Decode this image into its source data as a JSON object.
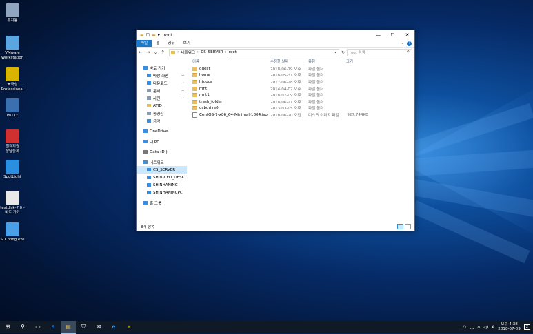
{
  "desktop": {
    "icons": [
      {
        "label": "휴지통",
        "icon": "recycle-bin-icon",
        "color": "#8fa5c0"
      },
      {
        "label": "VMware\nWorkstation",
        "icon": "vmware-icon",
        "color": "#5aa6e0"
      },
      {
        "label": "북극성\nProfessional",
        "icon": "compass-icon",
        "color": "#d8b400"
      },
      {
        "label": "PuTTY",
        "icon": "putty-icon",
        "color": "#3a6fb0"
      },
      {
        "label": "원격지원\n상담등록",
        "icon": "remote-support-icon",
        "color": "#d03030"
      },
      {
        "label": "SpotLight",
        "icon": "spotlight-icon",
        "color": "#2a8fe0"
      },
      {
        "label": "testdisk-7.0 -\n바로 가기",
        "icon": "document-icon",
        "color": "#e8e8e8"
      },
      {
        "label": "SLConfig.exe",
        "icon": "config-icon",
        "color": "#4aa0e8"
      }
    ]
  },
  "window": {
    "title": "root",
    "quick_access": [
      "▬",
      "☐",
      "▾"
    ],
    "controls": {
      "minimize": "—",
      "maximize": "☐",
      "close": "✕"
    },
    "ribbon_tabs": [
      {
        "label": "파일",
        "active": true
      },
      {
        "label": "홈",
        "active": false
      },
      {
        "label": "공유",
        "active": false
      },
      {
        "label": "보기",
        "active": false
      }
    ],
    "help": "?",
    "nav": {
      "back": "←",
      "forward": "→",
      "recent": "⌄",
      "up": "↑"
    },
    "path": [
      "네트워크",
      "CS_SERVER",
      "root"
    ],
    "path_sep": "›",
    "refresh": "↻",
    "search_placeholder": "root 검색",
    "nav_pane": {
      "items": [
        {
          "label": "바로 가기",
          "icon": "star-icon",
          "color": "#3a8fe0",
          "indent": false,
          "pinned": false,
          "selected": false
        },
        {
          "label": "바탕 화면",
          "icon": "desktop-icon",
          "color": "#3a8fe0",
          "indent": true,
          "pinned": true,
          "selected": false
        },
        {
          "label": "다운로드",
          "icon": "download-icon",
          "color": "#3a8fe0",
          "indent": true,
          "pinned": true,
          "selected": false
        },
        {
          "label": "문서",
          "icon": "documents-icon",
          "color": "#8a9bb0",
          "indent": true,
          "pinned": true,
          "selected": false
        },
        {
          "label": "사진",
          "icon": "pictures-icon",
          "color": "#8a9bb0",
          "indent": true,
          "pinned": true,
          "selected": false
        },
        {
          "label": "ATID",
          "icon": "folder-icon",
          "color": "#e8c05d",
          "indent": true,
          "pinned": false,
          "selected": false
        },
        {
          "label": "동영상",
          "icon": "videos-icon",
          "color": "#8a9bb0",
          "indent": true,
          "pinned": false,
          "selected": false
        },
        {
          "label": "음악",
          "icon": "music-icon",
          "color": "#3a8fe0",
          "indent": true,
          "pinned": false,
          "selected": false,
          "gap_after": true
        },
        {
          "label": "OneDrive",
          "icon": "onedrive-icon",
          "color": "#3a8fe0",
          "indent": false,
          "pinned": false,
          "selected": false,
          "gap_after": true
        },
        {
          "label": "내 PC",
          "icon": "pc-icon",
          "color": "#3a8fe0",
          "indent": false,
          "pinned": false,
          "selected": false,
          "gap_after": true
        },
        {
          "label": "Data (D:)",
          "icon": "drive-icon",
          "color": "#777777",
          "indent": false,
          "pinned": false,
          "selected": false,
          "gap_after": true
        },
        {
          "label": "네트워크",
          "icon": "network-icon",
          "color": "#3a8fe0",
          "indent": false,
          "pinned": false,
          "selected": false
        },
        {
          "label": "CS_SERVER",
          "icon": "computer-icon",
          "color": "#3a8fe0",
          "indent": true,
          "pinned": false,
          "selected": true
        },
        {
          "label": "SHIN-CEO_DESK",
          "icon": "computer-icon",
          "color": "#3a8fe0",
          "indent": true,
          "pinned": false,
          "selected": false
        },
        {
          "label": "SHINHANINC",
          "icon": "computer-icon",
          "color": "#3a8fe0",
          "indent": true,
          "pinned": false,
          "selected": false
        },
        {
          "label": "SHINHANINCPC",
          "icon": "computer-icon",
          "color": "#3a8fe0",
          "indent": true,
          "pinned": false,
          "selected": false,
          "gap_after": true
        },
        {
          "label": "홈 그룹",
          "icon": "homegroup-icon",
          "color": "#3a8fe0",
          "indent": false,
          "pinned": false,
          "selected": false
        }
      ],
      "pin_glyph": "📌"
    },
    "columns": {
      "name": "이름",
      "date": "수정한 날짜",
      "type": "유형",
      "size": "크기"
    },
    "files": [
      {
        "name": "guest",
        "date": "2018-06-19 오후...",
        "type": "파일 폴더",
        "size": "",
        "kind": "folder"
      },
      {
        "name": "home",
        "date": "2018-05-31 오후...",
        "type": "파일 폴더",
        "size": "",
        "kind": "folder"
      },
      {
        "name": "htdocs",
        "date": "2017-06-28 오후...",
        "type": "파일 폴더",
        "size": "",
        "kind": "folder"
      },
      {
        "name": "mnt",
        "date": "2014-04-02 오후...",
        "type": "파일 폴더",
        "size": "",
        "kind": "folder"
      },
      {
        "name": "mnt1",
        "date": "2018-07-09 오후...",
        "type": "파일 폴더",
        "size": "",
        "kind": "folder"
      },
      {
        "name": "trash_folder",
        "date": "2018-06-21 오후...",
        "type": "파일 폴더",
        "size": "",
        "kind": "folder"
      },
      {
        "name": "usbdrive0",
        "date": "2013-03-05 오후...",
        "type": "파일 폴더",
        "size": "",
        "kind": "folder"
      },
      {
        "name": "CentOS-7-x86_64-Minimal-1804.iso",
        "date": "2018-06-20 오전...",
        "type": "디스크 이미지 파일",
        "size": "927,744KB",
        "kind": "file"
      }
    ],
    "status": "8개 항목"
  },
  "taskbar": {
    "buttons": [
      {
        "glyph": "⊞",
        "icon": "start-icon",
        "active": false
      },
      {
        "glyph": "⚲",
        "icon": "search-icon",
        "active": false
      },
      {
        "glyph": "▭",
        "icon": "task-view-icon",
        "active": false
      },
      {
        "glyph": "e",
        "icon": "edge-icon",
        "active": false
      },
      {
        "glyph": "▤",
        "icon": "file-explorer-icon",
        "active": true
      },
      {
        "glyph": "⛉",
        "icon": "store-icon",
        "active": false
      },
      {
        "glyph": "✉",
        "icon": "mail-icon",
        "active": false
      },
      {
        "glyph": "e",
        "icon": "ie-icon",
        "active": false
      },
      {
        "glyph": "⌖",
        "icon": "compass-icon",
        "active": false
      }
    ],
    "tray": {
      "people": "⚇",
      "chevron": "︿",
      "network": "⌂",
      "volume": "◁)",
      "ime": "A",
      "time": "오후 4:38",
      "date": "2018-07-09",
      "notifications": "2"
    }
  },
  "colors": {
    "accent": "#1979ca",
    "selection": "#cce8ff",
    "folder": "#e8c05d"
  }
}
